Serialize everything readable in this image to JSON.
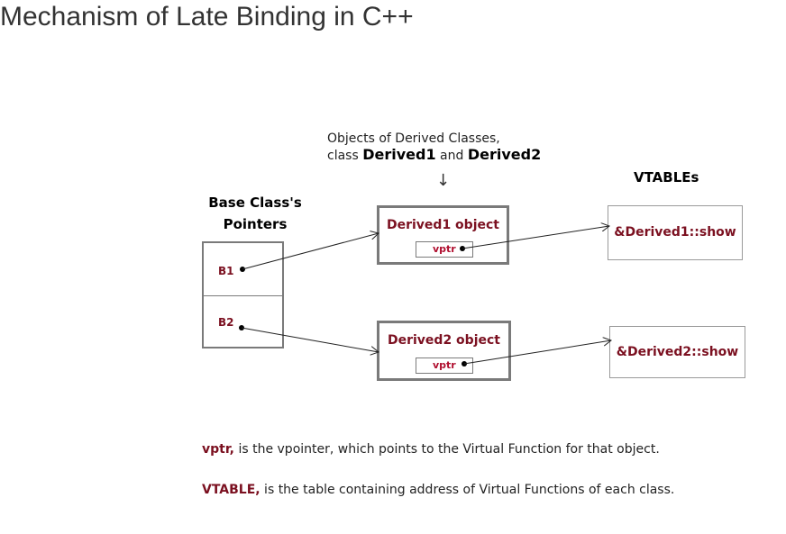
{
  "title": "Mechanism of Late Binding in C++",
  "caption": {
    "line1": "Objects of Derived Classes,",
    "line2_prefix": "class ",
    "class1": "Derived1",
    "and": " and ",
    "class2": "Derived2",
    "down_arrow": "↓"
  },
  "base_heading": {
    "line1": "Base Class's",
    "line2": "Pointers"
  },
  "vtables_heading": "VTABLEs",
  "pointers": [
    {
      "label": "B1"
    },
    {
      "label": "B2"
    }
  ],
  "objects": [
    {
      "title": "Derived1 object",
      "field": "vptr"
    },
    {
      "title": "Derived2 object",
      "field": "vptr"
    }
  ],
  "vtables": [
    {
      "entry": "&Derived1::show"
    },
    {
      "entry": "&Derived2::show"
    }
  ],
  "notes": [
    {
      "term": "vptr,",
      "text": " is the vpointer, which points to the Virtual Function for that object."
    },
    {
      "term": "VTABLE,",
      "text": " is the table containing address of Virtual Functions of each class."
    }
  ],
  "colors": {
    "accent": "#7b1020",
    "border": "#7a7a7a",
    "text": "#222222"
  }
}
